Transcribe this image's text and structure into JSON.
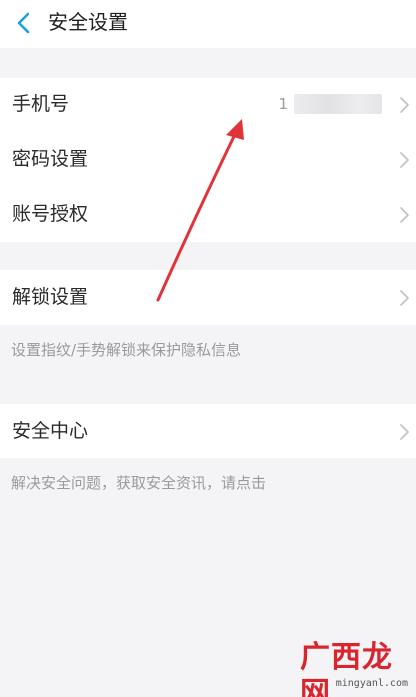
{
  "header": {
    "title": "安全设置",
    "back_icon": "chevron-left-icon",
    "accent_color": "#1aa3d8"
  },
  "account_section": {
    "items": [
      {
        "label": "手机号",
        "value_prefix": "1",
        "value_masked": true,
        "icon": "chevron-right-icon"
      },
      {
        "label": "密码设置",
        "icon": "chevron-right-icon"
      },
      {
        "label": "账号授权",
        "icon": "chevron-right-icon"
      }
    ]
  },
  "unlock_section": {
    "label": "解锁设置",
    "hint": "设置指纹/手势解锁来保护隐私信息",
    "icon": "chevron-right-icon"
  },
  "security_section": {
    "label": "安全中心",
    "hint": "解决安全问题，获取安全资讯，请点击",
    "icon": "chevron-right-icon"
  },
  "annotation": {
    "arrow_color": "#e0343a",
    "target": "手机号"
  },
  "watermark": {
    "text": "广西龙网",
    "sub": "mingyanl.com"
  }
}
